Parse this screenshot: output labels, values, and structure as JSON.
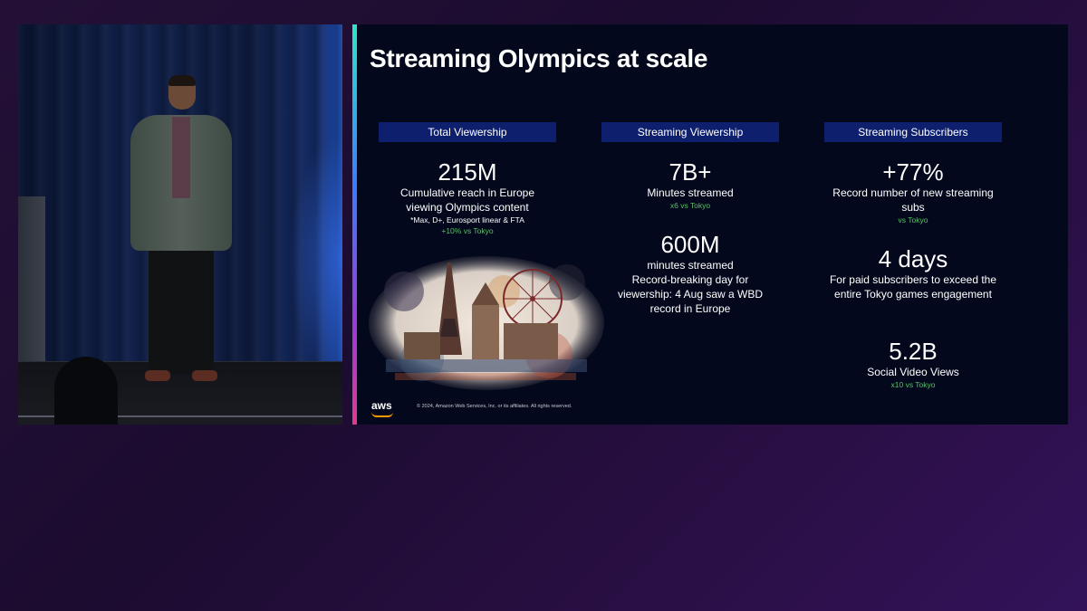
{
  "slide": {
    "title": "Streaming Olympics at scale",
    "columns": [
      {
        "header": "Total Viewership",
        "stat": "215M",
        "desc_lines": [
          "Cumulative reach in Europe",
          "viewing Olympics content"
        ],
        "note": "*Max, D+, Eurosport linear & FTA",
        "comparison": "+10% vs Tokyo"
      },
      {
        "header": "Streaming Viewership",
        "stat": "7B+",
        "desc": "Minutes streamed",
        "comparison": "x6 vs Tokyo",
        "stat2": "600M",
        "desc2_lines": [
          "minutes streamed",
          "Record-breaking day for",
          "viewership: 4 Aug saw a WBD",
          "record in Europe"
        ]
      },
      {
        "header": "Streaming Subscribers",
        "stat": "+77%",
        "desc_lines": [
          "Record number of new streaming",
          "subs"
        ],
        "comparison": "vs Tokyo",
        "stat2": "4 days",
        "desc2_lines": [
          "For paid subscribers to exceed the",
          "entire Tokyo games engagement"
        ],
        "stat3": "5.2B",
        "desc3": "Social Video Views",
        "comparison3": "x10 vs Tokyo"
      }
    ],
    "footer": {
      "logo": "aws",
      "copyright": "© 2024, Amazon Web Services, Inc. or its affiliates. All rights reserved."
    }
  },
  "colors": {
    "background": "#241036",
    "slide_bg": "#04081c",
    "header_bg": "#0e1f6e",
    "comparison_green": "#5bbf6a",
    "aws_orange": "#ff9900"
  }
}
